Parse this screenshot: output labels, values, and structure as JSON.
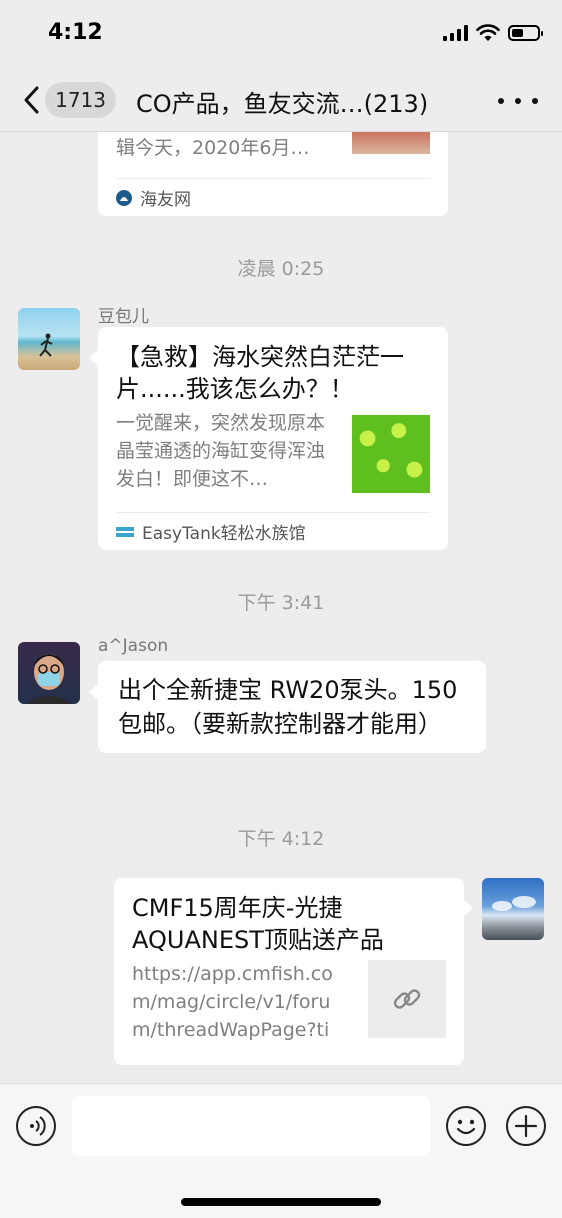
{
  "status": {
    "time": "4:12"
  },
  "nav": {
    "badge": "1713",
    "title": "CO产品，鱼友交流…(213)"
  },
  "messages": {
    "prev_card": {
      "desc": "辑今天，2020年6月…",
      "source": "海友网"
    },
    "ts1": "凌晨 0:25",
    "msg1": {
      "sender": "豆包儿",
      "title": "【急救】海水突然白茫茫一片......我该怎么办？！",
      "desc": "一觉醒来，突然发现原本晶莹通透的海缸变得浑浊发白！即便这不…",
      "source": "EasyTank轻松水族馆"
    },
    "ts2": "下午 3:41",
    "msg2": {
      "sender": "a^Jason",
      "text": "出个全新捷宝 RW20泵头。150包邮。（要新款控制器才能用）"
    },
    "ts3": "下午 4:12",
    "msg3": {
      "title": "CMF15周年庆-光捷AQUANEST顶贴送产品",
      "desc": "https://app.cmfish.com/mag/circle/v1/forum/threadWapPage?tid…"
    }
  },
  "icons": {
    "back": "chevron-left-icon",
    "more": "more-icon",
    "voice": "voice-icon",
    "emoji": "emoji-icon",
    "plus": "plus-icon",
    "link": "link-icon",
    "source": "source-logo-icon"
  },
  "colors": {
    "background": "#ededed",
    "bubble": "#ffffff",
    "timestamp": "#9b9b9b"
  }
}
